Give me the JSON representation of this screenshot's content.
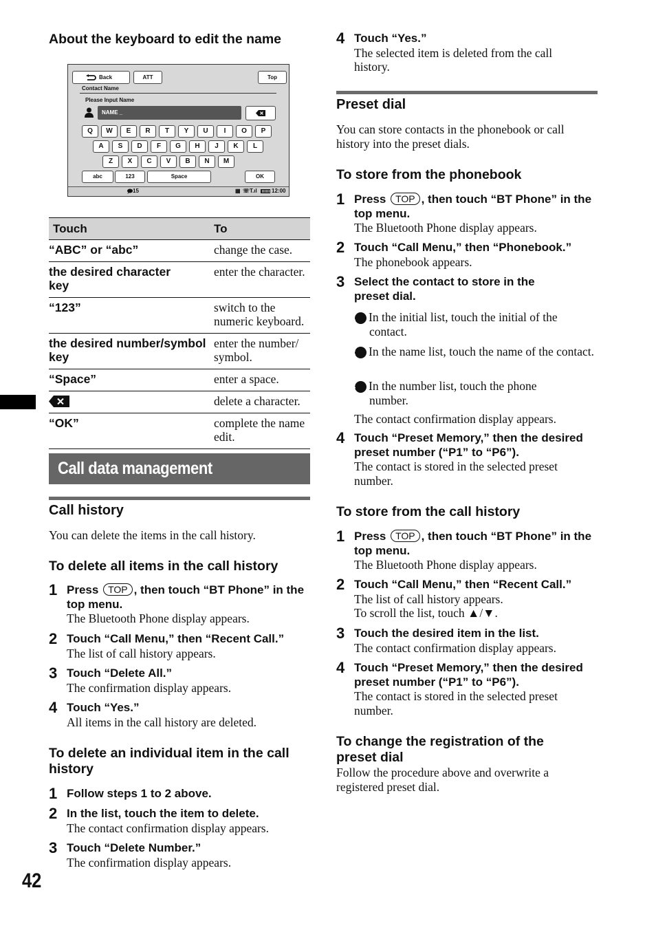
{
  "page_number": "42",
  "left": {
    "keyboard_heading": "About the keyboard to edit the name",
    "device_screen": {
      "back_label": "Back",
      "att_label": "ATT",
      "top_label": "Top",
      "title": "Contact Name",
      "prompt": "Please Input Name",
      "name_field_value": "NAME _",
      "row1": [
        "Q",
        "W",
        "E",
        "R",
        "T",
        "Y",
        "U",
        "I",
        "O",
        "P"
      ],
      "row2": [
        "A",
        "S",
        "D",
        "F",
        "G",
        "H",
        "J",
        "K",
        "L"
      ],
      "row3": [
        "Z",
        "X",
        "C",
        "V",
        "B",
        "N",
        "M"
      ],
      "abc_label": "abc",
      "num_label": "123",
      "space_label": "Space",
      "ok_label": "OK",
      "message_count": "15",
      "clock": "12:00",
      "icons": [
        "back-arrow-icon",
        "person-icon",
        "backspace-icon",
        "message-icon",
        "phone-book-icon",
        "phone-icon",
        "signal-icon",
        "battery-icon"
      ]
    },
    "table": {
      "headers": [
        "Touch",
        "To"
      ],
      "rows": [
        {
          "touch": "“ABC” or “abc”",
          "to": "change the case."
        },
        {
          "touch": "the desired character key",
          "to": "enter the character."
        },
        {
          "touch": "“123”",
          "to": "switch to the numeric keyboard."
        },
        {
          "touch": "the desired number/symbol key",
          "to": "enter the number/ symbol."
        },
        {
          "touch": "“Space”",
          "to": "enter a space."
        },
        {
          "touch": "",
          "touch_icon": "backspace-icon",
          "to": "delete a character."
        },
        {
          "touch": "“OK”",
          "to": "complete the name edit."
        }
      ]
    },
    "section_banner": "Call data management",
    "call_history": {
      "title": "Call history",
      "intro": "You can delete the items in the call history.",
      "delete_all": {
        "title": "To delete all items in the call history",
        "steps": [
          {
            "num": "1",
            "lead_pre": "Press",
            "key": "TOP",
            "lead_post": ", then touch “BT Phone” in the top menu.",
            "desc": "The Bluetooth Phone display appears."
          },
          {
            "num": "2",
            "lead": "Touch “Call Menu,” then “Recent Call.”",
            "desc": "The list of call history appears."
          },
          {
            "num": "3",
            "lead": "Touch “Delete All.”",
            "desc": "The confirmation display appears."
          },
          {
            "num": "4",
            "lead": "Touch “Yes.”",
            "desc": "All items in the call history are deleted."
          }
        ]
      },
      "delete_individual": {
        "title": "To delete an individual item in the call history",
        "steps": [
          {
            "num": "1",
            "lead": "Follow steps 1 to 2 above.",
            "desc": ""
          },
          {
            "num": "2",
            "lead": "In the list, touch the item to delete.",
            "desc": "The contact confirmation display appears."
          },
          {
            "num": "3",
            "lead": "Touch “Delete Number.”",
            "desc": "The confirmation display appears."
          }
        ]
      }
    }
  },
  "right": {
    "continued_step": {
      "num": "4",
      "lead": "Touch “Yes.”",
      "desc": "The selected item is deleted from the call history."
    },
    "preset_dial": {
      "title": "Preset dial",
      "intro": "You can store contacts in the phonebook or call history into the preset dials.",
      "from_phonebook": {
        "title": "To store from the phonebook",
        "steps": [
          {
            "num": "1",
            "lead_pre": "Press",
            "key": "TOP",
            "lead_post": ", then touch “BT Phone” in the top menu.",
            "desc": "The Bluetooth Phone display appears."
          },
          {
            "num": "2",
            "lead": "Touch “Call Menu,” then “Phonebook.”",
            "desc": "The phonebook appears."
          },
          {
            "num": "3",
            "lead": "Select the contact to store in the preset dial.",
            "desc": ""
          },
          {
            "num": "4",
            "lead": "Touch “Preset Memory,” then the desired preset number (“P1” to “P6”).",
            "desc": "The contact is stored in the selected preset number."
          }
        ],
        "substeps": [
          {
            "num": "1",
            "text": "In the initial list, touch the initial of the contact."
          },
          {
            "num": "2",
            "text": "In the name list, touch the name of the contact."
          },
          {
            "num": "3",
            "text": "In the number list, touch the phone number."
          }
        ],
        "after_substeps": "The contact confirmation display appears."
      },
      "from_call_history": {
        "title": "To store from the call history",
        "steps": [
          {
            "num": "1",
            "lead_pre": "Press",
            "key": "TOP",
            "lead_post": ", then touch “BT Phone” in the top menu.",
            "desc": "The Bluetooth Phone display appears."
          },
          {
            "num": "2",
            "lead": "Touch “Call Menu,” then “Recent Call.”",
            "desc": "The list of call history appears.",
            "desc2": "To scroll the list, touch ▲/▼."
          },
          {
            "num": "3",
            "lead": "Touch the desired item in the list.",
            "desc": "The contact confirmation display appears."
          },
          {
            "num": "4",
            "lead": "Touch “Preset Memory,” then the desired preset number (“P1” to “P6”).",
            "desc": "The contact is stored in the selected preset number."
          }
        ]
      },
      "change_registration": {
        "title": "To change the registration of the preset dial",
        "text": "Follow the procedure above and overwrite a registered preset dial."
      }
    }
  }
}
